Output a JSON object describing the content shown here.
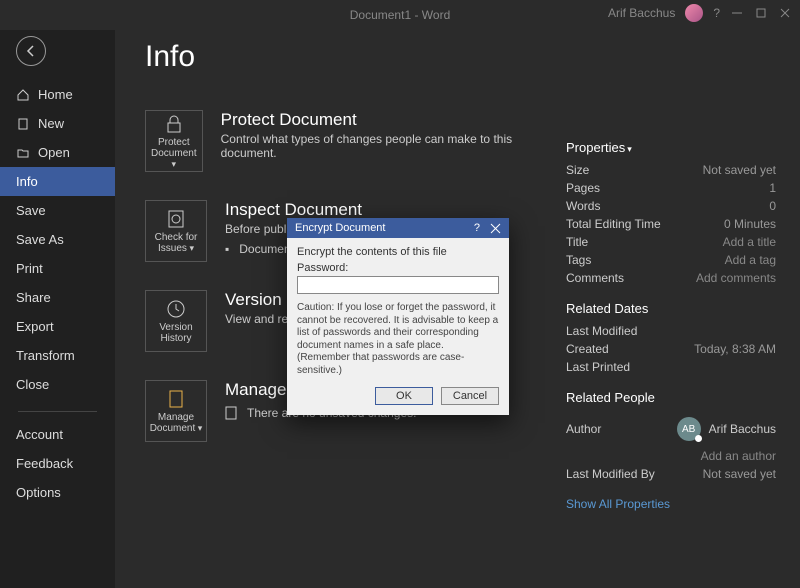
{
  "titlebar": {
    "doc": "Document1",
    "app": "Word",
    "user": "Arif Bacchus"
  },
  "sidebar": {
    "items": [
      {
        "label": "Home"
      },
      {
        "label": "New"
      },
      {
        "label": "Open"
      },
      {
        "label": "Info"
      },
      {
        "label": "Save"
      },
      {
        "label": "Save As"
      },
      {
        "label": "Print"
      },
      {
        "label": "Share"
      },
      {
        "label": "Export"
      },
      {
        "label": "Transform"
      },
      {
        "label": "Close"
      }
    ],
    "bottom": [
      {
        "label": "Account"
      },
      {
        "label": "Feedback"
      },
      {
        "label": "Options"
      }
    ]
  },
  "page": {
    "title": "Info",
    "protect": {
      "tile": "Protect\nDocument",
      "title": "Protect Document",
      "desc": "Control what types of changes people can make to this document."
    },
    "inspect": {
      "tile": "Check for\nIssues",
      "title": "Inspect Document",
      "desc": "Before publishing this file, be aware that it contains:",
      "bullet": "Document properties and author's name"
    },
    "history": {
      "tile": "Version\nHistory",
      "title": "Version History",
      "desc": "View and restore previous versions."
    },
    "manage": {
      "tile": "Manage\nDocument",
      "title": "Manage Document",
      "desc": "There are no unsaved changes."
    }
  },
  "dialog": {
    "title": "Encrypt Document",
    "subtitle": "Encrypt the contents of this file",
    "password_label": "Password:",
    "password_value": "",
    "caution": "Caution: If you lose or forget the password, it cannot be recovered. It is advisable to keep a list of passwords and their corresponding document names in a safe place.\n(Remember that passwords are case-sensitive.)",
    "ok": "OK",
    "cancel": "Cancel"
  },
  "props": {
    "heading": "Properties",
    "rows": {
      "size_l": "Size",
      "size_v": "Not saved yet",
      "pages_l": "Pages",
      "pages_v": "1",
      "words_l": "Words",
      "words_v": "0",
      "tet_l": "Total Editing Time",
      "tet_v": "0 Minutes",
      "title_l": "Title",
      "title_v": "Add a title",
      "tags_l": "Tags",
      "tags_v": "Add a tag",
      "comments_l": "Comments",
      "comments_v": "Add comments"
    },
    "dates": {
      "heading": "Related Dates",
      "lm_l": "Last Modified",
      "lm_v": "",
      "cr_l": "Created",
      "cr_v": "Today, 8:38 AM",
      "lp_l": "Last Printed",
      "lp_v": ""
    },
    "people": {
      "heading": "Related People",
      "author_l": "Author",
      "author_name": "Arif Bacchus",
      "author_initials": "AB",
      "add_author": "Add an author",
      "lmb_l": "Last Modified By",
      "lmb_v": "Not saved yet"
    },
    "show_all": "Show All Properties"
  }
}
